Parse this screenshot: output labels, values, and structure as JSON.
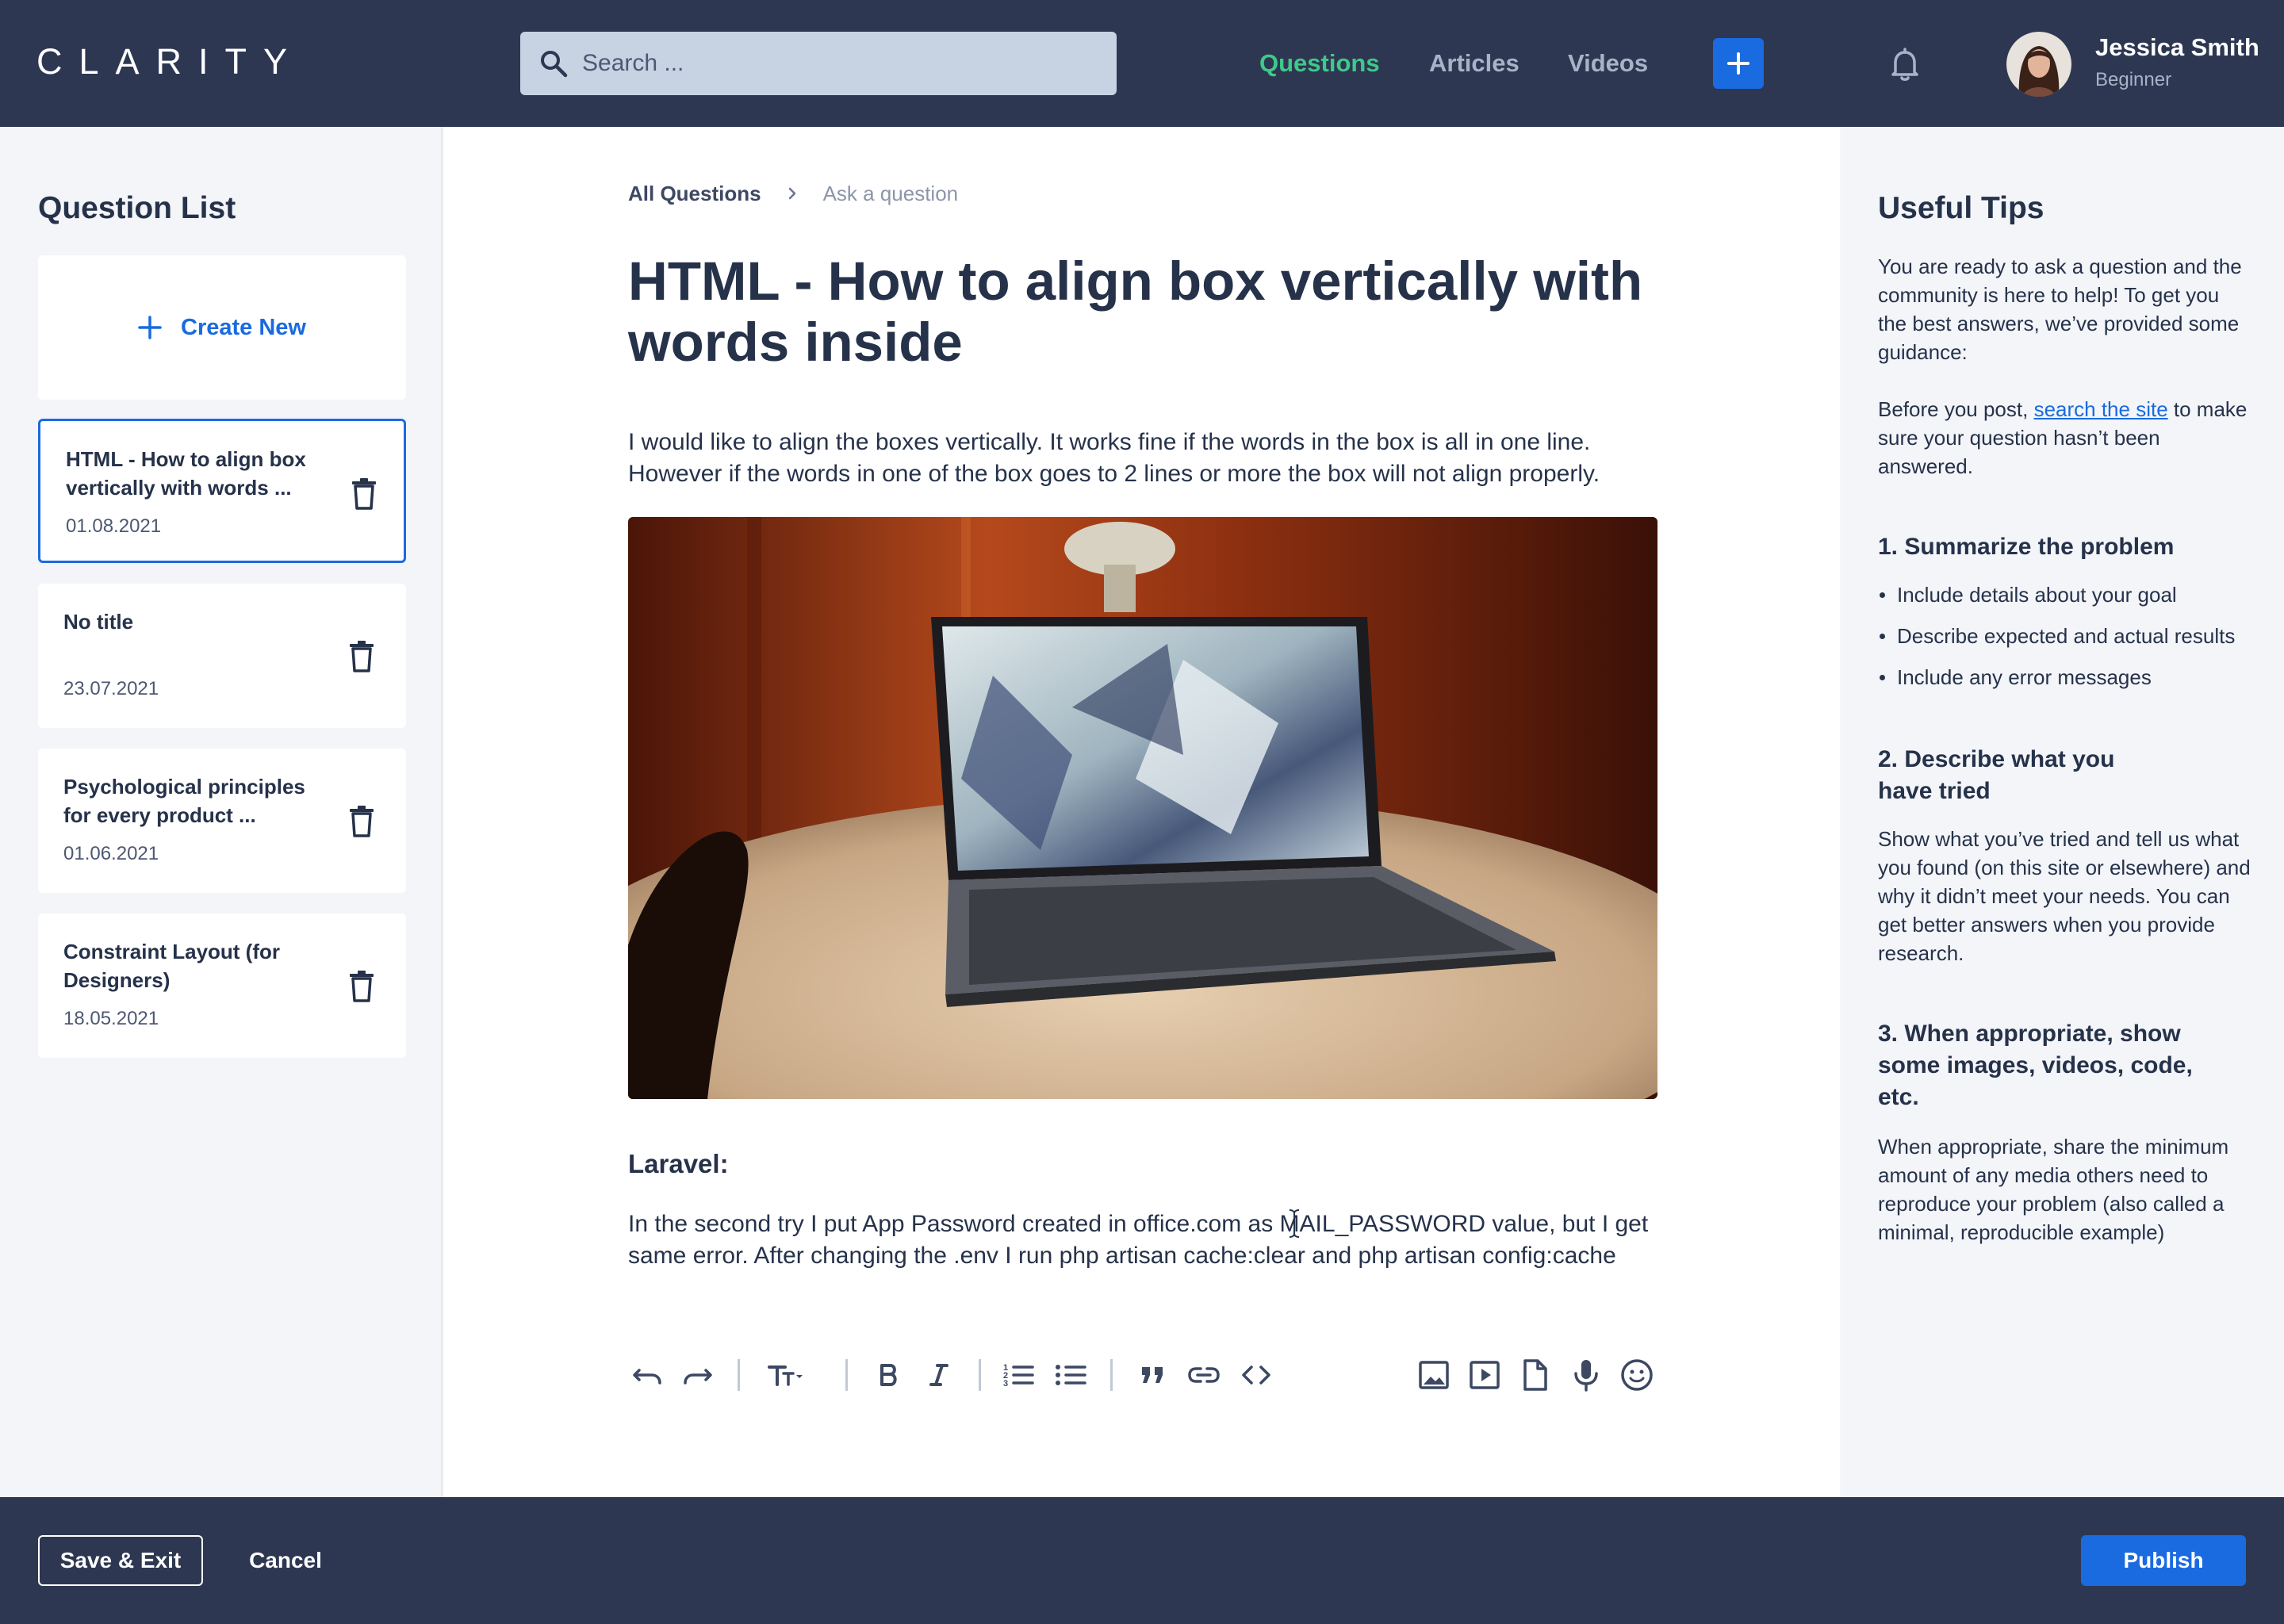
{
  "header": {
    "logo": "CLARITY",
    "search_placeholder": "Search ...",
    "nav": [
      {
        "label": "Questions",
        "active": true
      },
      {
        "label": "Articles",
        "active": false
      },
      {
        "label": "Videos",
        "active": false
      }
    ],
    "user": {
      "name": "Jessica Smith",
      "role": "Beginner"
    }
  },
  "sidebar": {
    "title": "Question List",
    "create_label": "Create New",
    "questions": [
      {
        "title": "HTML - How to align box vertically with words ...",
        "date": "01.08.2021",
        "selected": true
      },
      {
        "title": "No title",
        "date": "23.07.2021",
        "selected": false
      },
      {
        "title": "Psychological principles for every product ...",
        "date": "01.06.2021",
        "selected": false
      },
      {
        "title": "Constraint Layout (for Designers)",
        "date": "18.05.2021",
        "selected": false
      }
    ]
  },
  "main": {
    "breadcrumb_root": "All Questions",
    "breadcrumb_current": "Ask a question",
    "title": "HTML - How to align box vertically with words inside",
    "intro": "I would like to align the boxes vertically. It works fine if the words in the box is all in one line. However if the words in one of the box goes to 2 lines or more the box will not align properly.",
    "subheading": "Laravel:",
    "body": "In the second try I put App Password created in office.com as MAIL_PASSWORD value, but I get same error. After changing the .env I run php artisan cache:clear and php artisan config:cache"
  },
  "toolbar": {
    "icons": [
      "undo-icon",
      "redo-icon",
      "text-size-icon",
      "bold-icon",
      "italic-icon",
      "ordered-list-icon",
      "bullet-list-icon",
      "quote-icon",
      "link-icon",
      "code-icon",
      "image-icon",
      "video-icon",
      "file-icon",
      "microphone-icon",
      "emoji-icon"
    ]
  },
  "tips": {
    "title": "Useful Tips",
    "intro": "You are ready to ask a question and the community is here to help! To get you the best answers, we’ve provided some guidance:",
    "before_pre": "Before you post, ",
    "before_link": "search the site",
    "before_post": " to make sure your question hasn’t been answered.",
    "s1_heading": "1. Summarize the problem",
    "s1_items": [
      "Include details about your goal",
      "Describe expected and actual results",
      "Include any error messages"
    ],
    "s2_heading": "2. Describe what you have tried",
    "s2_text": "Show what you’ve tried and tell us what you found (on this site or elsewhere) and why it didn’t meet your needs. You can get better answers when you provide research.",
    "s3_heading": "3. When appropriate, show some images, videos, code, etc.",
    "s3_text": "When appropriate, share the minimum amount of any media others need to reproduce your problem (also called a minimal, reproducible example)"
  },
  "footer": {
    "save_label": "Save & Exit",
    "cancel_label": "Cancel",
    "publish_label": "Publish"
  },
  "colors": {
    "navy": "#2d3752",
    "accent_blue": "#1a6ae0",
    "active_green": "#3ec98a",
    "text_dark": "#26324a"
  }
}
